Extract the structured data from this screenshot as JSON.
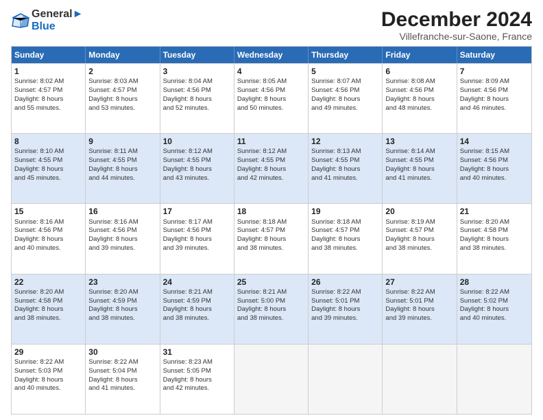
{
  "logo": {
    "line1": "General",
    "line2": "Blue"
  },
  "title": "December 2024",
  "subtitle": "Villefranche-sur-Saone, France",
  "weekdays": [
    "Sunday",
    "Monday",
    "Tuesday",
    "Wednesday",
    "Thursday",
    "Friday",
    "Saturday"
  ],
  "rows": [
    [
      {
        "day": "1",
        "lines": [
          "Sunrise: 8:02 AM",
          "Sunset: 4:57 PM",
          "Daylight: 8 hours",
          "and 55 minutes."
        ]
      },
      {
        "day": "2",
        "lines": [
          "Sunrise: 8:03 AM",
          "Sunset: 4:57 PM",
          "Daylight: 8 hours",
          "and 53 minutes."
        ]
      },
      {
        "day": "3",
        "lines": [
          "Sunrise: 8:04 AM",
          "Sunset: 4:56 PM",
          "Daylight: 8 hours",
          "and 52 minutes."
        ]
      },
      {
        "day": "4",
        "lines": [
          "Sunrise: 8:05 AM",
          "Sunset: 4:56 PM",
          "Daylight: 8 hours",
          "and 50 minutes."
        ]
      },
      {
        "day": "5",
        "lines": [
          "Sunrise: 8:07 AM",
          "Sunset: 4:56 PM",
          "Daylight: 8 hours",
          "and 49 minutes."
        ]
      },
      {
        "day": "6",
        "lines": [
          "Sunrise: 8:08 AM",
          "Sunset: 4:56 PM",
          "Daylight: 8 hours",
          "and 48 minutes."
        ]
      },
      {
        "day": "7",
        "lines": [
          "Sunrise: 8:09 AM",
          "Sunset: 4:56 PM",
          "Daylight: 8 hours",
          "and 46 minutes."
        ]
      }
    ],
    [
      {
        "day": "8",
        "lines": [
          "Sunrise: 8:10 AM",
          "Sunset: 4:55 PM",
          "Daylight: 8 hours",
          "and 45 minutes."
        ]
      },
      {
        "day": "9",
        "lines": [
          "Sunrise: 8:11 AM",
          "Sunset: 4:55 PM",
          "Daylight: 8 hours",
          "and 44 minutes."
        ]
      },
      {
        "day": "10",
        "lines": [
          "Sunrise: 8:12 AM",
          "Sunset: 4:55 PM",
          "Daylight: 8 hours",
          "and 43 minutes."
        ]
      },
      {
        "day": "11",
        "lines": [
          "Sunrise: 8:12 AM",
          "Sunset: 4:55 PM",
          "Daylight: 8 hours",
          "and 42 minutes."
        ]
      },
      {
        "day": "12",
        "lines": [
          "Sunrise: 8:13 AM",
          "Sunset: 4:55 PM",
          "Daylight: 8 hours",
          "and 41 minutes."
        ]
      },
      {
        "day": "13",
        "lines": [
          "Sunrise: 8:14 AM",
          "Sunset: 4:55 PM",
          "Daylight: 8 hours",
          "and 41 minutes."
        ]
      },
      {
        "day": "14",
        "lines": [
          "Sunrise: 8:15 AM",
          "Sunset: 4:56 PM",
          "Daylight: 8 hours",
          "and 40 minutes."
        ]
      }
    ],
    [
      {
        "day": "15",
        "lines": [
          "Sunrise: 8:16 AM",
          "Sunset: 4:56 PM",
          "Daylight: 8 hours",
          "and 40 minutes."
        ]
      },
      {
        "day": "16",
        "lines": [
          "Sunrise: 8:16 AM",
          "Sunset: 4:56 PM",
          "Daylight: 8 hours",
          "and 39 minutes."
        ]
      },
      {
        "day": "17",
        "lines": [
          "Sunrise: 8:17 AM",
          "Sunset: 4:56 PM",
          "Daylight: 8 hours",
          "and 39 minutes."
        ]
      },
      {
        "day": "18",
        "lines": [
          "Sunrise: 8:18 AM",
          "Sunset: 4:57 PM",
          "Daylight: 8 hours",
          "and 38 minutes."
        ]
      },
      {
        "day": "19",
        "lines": [
          "Sunrise: 8:18 AM",
          "Sunset: 4:57 PM",
          "Daylight: 8 hours",
          "and 38 minutes."
        ]
      },
      {
        "day": "20",
        "lines": [
          "Sunrise: 8:19 AM",
          "Sunset: 4:57 PM",
          "Daylight: 8 hours",
          "and 38 minutes."
        ]
      },
      {
        "day": "21",
        "lines": [
          "Sunrise: 8:20 AM",
          "Sunset: 4:58 PM",
          "Daylight: 8 hours",
          "and 38 minutes."
        ]
      }
    ],
    [
      {
        "day": "22",
        "lines": [
          "Sunrise: 8:20 AM",
          "Sunset: 4:58 PM",
          "Daylight: 8 hours",
          "and 38 minutes."
        ]
      },
      {
        "day": "23",
        "lines": [
          "Sunrise: 8:20 AM",
          "Sunset: 4:59 PM",
          "Daylight: 8 hours",
          "and 38 minutes."
        ]
      },
      {
        "day": "24",
        "lines": [
          "Sunrise: 8:21 AM",
          "Sunset: 4:59 PM",
          "Daylight: 8 hours",
          "and 38 minutes."
        ]
      },
      {
        "day": "25",
        "lines": [
          "Sunrise: 8:21 AM",
          "Sunset: 5:00 PM",
          "Daylight: 8 hours",
          "and 38 minutes."
        ]
      },
      {
        "day": "26",
        "lines": [
          "Sunrise: 8:22 AM",
          "Sunset: 5:01 PM",
          "Daylight: 8 hours",
          "and 39 minutes."
        ]
      },
      {
        "day": "27",
        "lines": [
          "Sunrise: 8:22 AM",
          "Sunset: 5:01 PM",
          "Daylight: 8 hours",
          "and 39 minutes."
        ]
      },
      {
        "day": "28",
        "lines": [
          "Sunrise: 8:22 AM",
          "Sunset: 5:02 PM",
          "Daylight: 8 hours",
          "and 40 minutes."
        ]
      }
    ],
    [
      {
        "day": "29",
        "lines": [
          "Sunrise: 8:22 AM",
          "Sunset: 5:03 PM",
          "Daylight: 8 hours",
          "and 40 minutes."
        ]
      },
      {
        "day": "30",
        "lines": [
          "Sunrise: 8:22 AM",
          "Sunset: 5:04 PM",
          "Daylight: 8 hours",
          "and 41 minutes."
        ]
      },
      {
        "day": "31",
        "lines": [
          "Sunrise: 8:23 AM",
          "Sunset: 5:05 PM",
          "Daylight: 8 hours",
          "and 42 minutes."
        ]
      },
      {
        "day": "",
        "lines": []
      },
      {
        "day": "",
        "lines": []
      },
      {
        "day": "",
        "lines": []
      },
      {
        "day": "",
        "lines": []
      }
    ]
  ]
}
